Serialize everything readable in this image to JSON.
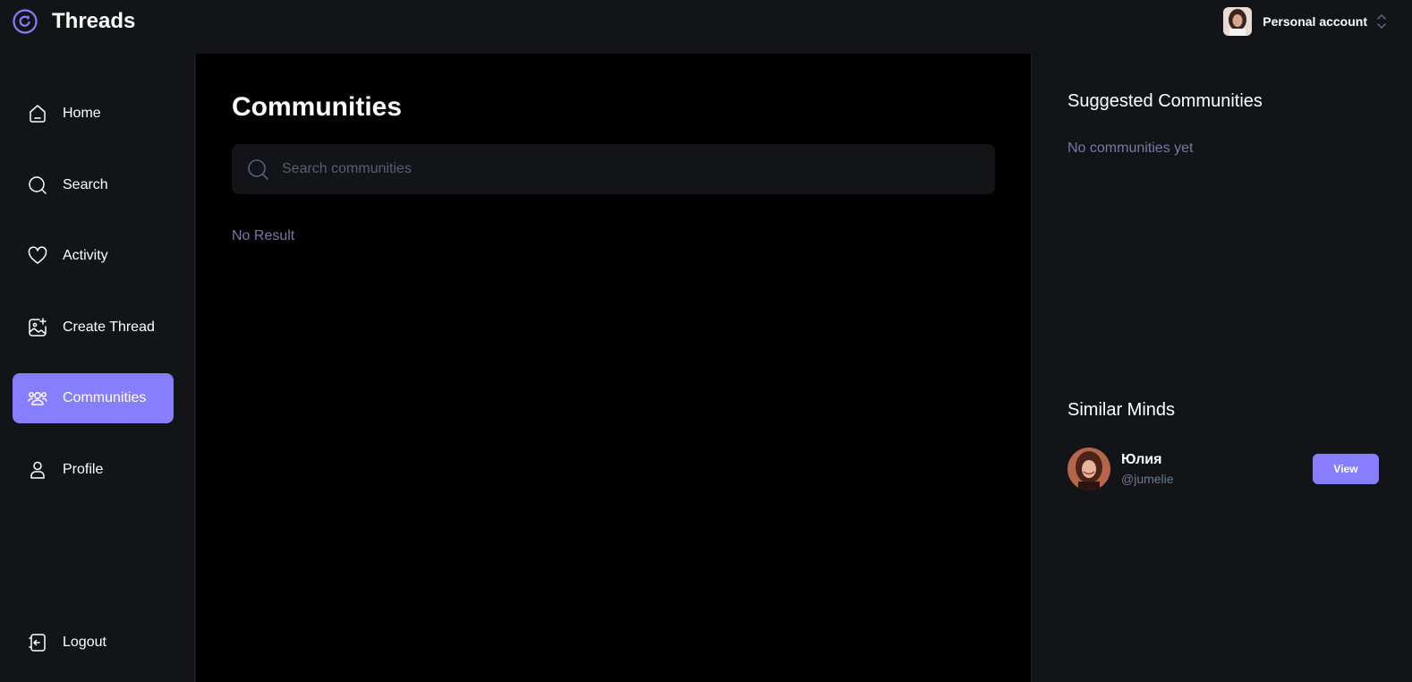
{
  "app": {
    "brand": "Threads",
    "logo_icon": "threads-logo-icon",
    "accent_color": "#877EFF"
  },
  "account": {
    "label": "Personal account",
    "avatar_icon": "user-avatar-icon",
    "switch_icon": "chevron-up-down-icon"
  },
  "sidebar": {
    "items": [
      {
        "label": "Home",
        "icon": "home-icon"
      },
      {
        "label": "Search",
        "icon": "search-icon"
      },
      {
        "label": "Activity",
        "icon": "heart-icon"
      },
      {
        "label": "Create Thread",
        "icon": "create-image-icon"
      },
      {
        "label": "Communities",
        "icon": "communities-icon",
        "active": true
      },
      {
        "label": "Profile",
        "icon": "profile-icon"
      }
    ],
    "logout": {
      "label": "Logout",
      "icon": "logout-icon"
    }
  },
  "main": {
    "title": "Communities",
    "search": {
      "placeholder": "Search communities",
      "value": ""
    },
    "empty_text": "No Result"
  },
  "rightbar": {
    "suggested": {
      "title": "Suggested Communities",
      "empty_text": "No communities yet"
    },
    "similar": {
      "title": "Similar Minds",
      "users": [
        {
          "name": "Юлия",
          "handle": "@jumelie",
          "button_label": "View"
        }
      ]
    }
  }
}
